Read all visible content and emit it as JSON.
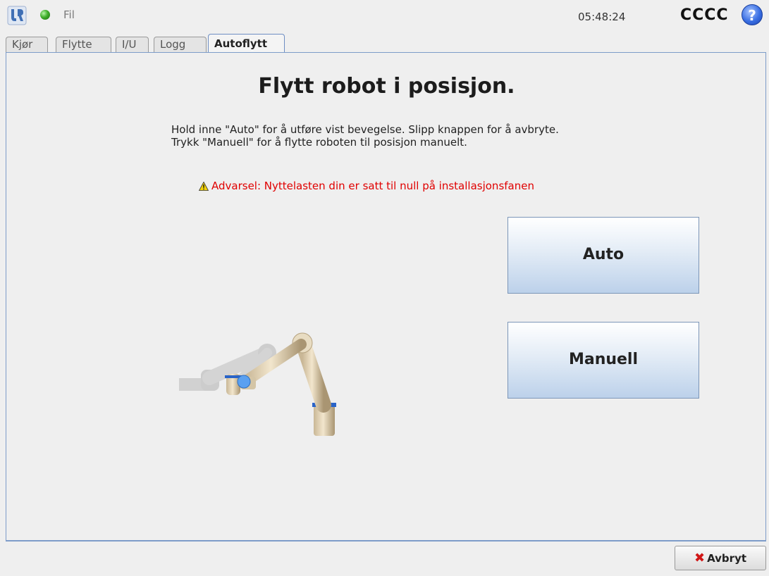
{
  "header": {
    "file_menu": "Fil",
    "time": "05:48:24",
    "robot_name": "CCCC",
    "help_glyph": "?"
  },
  "tabs": [
    {
      "label": "Kjør"
    },
    {
      "label": "Flytte"
    },
    {
      "label": "I/U"
    },
    {
      "label": "Logg"
    },
    {
      "label": "Autoflytt",
      "active": true
    }
  ],
  "main": {
    "title": "Flytt robot i posisjon.",
    "description_line1": "Hold inne \"Auto\" for å utføre vist bevegelse. Slipp knappen for å avbryte.",
    "description_line2": "Trykk \"Manuell\" for å flytte roboten til posisjon manuelt.",
    "warning": "Advarsel: Nyttelasten din er satt til null på installasjonsfanen",
    "auto_label": "Auto",
    "manual_label": "Manuell"
  },
  "footer": {
    "cancel_label": "Avbryt"
  },
  "colors": {
    "accent_border": "#7d9cc9",
    "warning_text": "#e00000",
    "status_ok": "#3fae2b"
  },
  "icons": [
    "ur-logo-icon",
    "status-ok-icon",
    "help-icon",
    "warning-icon",
    "robot-arm-illustration",
    "close-x-icon"
  ]
}
